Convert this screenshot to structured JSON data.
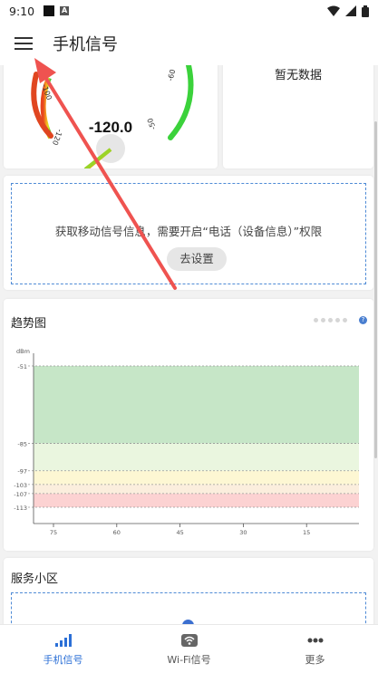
{
  "status_bar": {
    "time": "9:10"
  },
  "app_bar": {
    "title": "手机信号"
  },
  "gauge": {
    "value": "-120.0",
    "ticks": [
      "-100",
      "-120",
      "-60",
      "-50"
    ]
  },
  "no_data": {
    "text": "暂无数据"
  },
  "permission": {
    "message": "获取移动信号信息，需要开启“电话（设备信息）”权限",
    "button": "去设置"
  },
  "trend": {
    "title": "趋势图",
    "accent": "#4a7fd0"
  },
  "chart_data": {
    "type": "area",
    "title": "趋势图",
    "ylabel": "dBm",
    "y_ticks": [
      "-51",
      "-85",
      "-97",
      "-103",
      "-107",
      "-113"
    ],
    "x_ticks": [
      "75",
      "60",
      "45",
      "30",
      "15"
    ],
    "bands": [
      {
        "from": -51,
        "to": -85,
        "color": "#c6e6c7"
      },
      {
        "from": -85,
        "to": -97,
        "color": "#eaf6df"
      },
      {
        "from": -97,
        "to": -103,
        "color": "#fdf7d3"
      },
      {
        "from": -103,
        "to": -107,
        "color": "#fbeedd"
      },
      {
        "from": -107,
        "to": -113,
        "color": "#fcd2d2"
      }
    ]
  },
  "cell": {
    "title": "服务小区"
  },
  "nav": [
    {
      "label": "手机信号"
    },
    {
      "label": "Wi-Fi信号"
    },
    {
      "label": "更多"
    }
  ]
}
